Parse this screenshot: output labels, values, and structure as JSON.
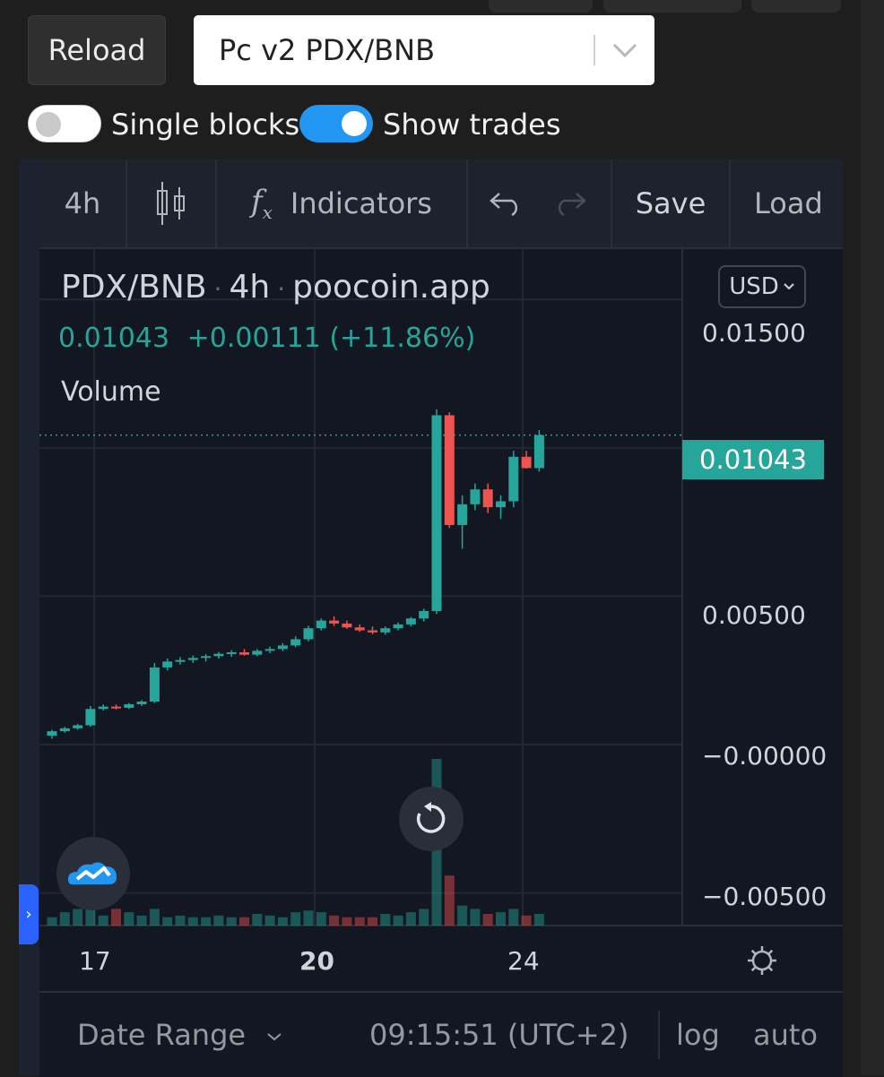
{
  "top_controls": {
    "reload_label": "Reload",
    "pair_value": "Pc v2 PDX/BNB"
  },
  "toggles": {
    "single_blocks": {
      "label": "Single blocks",
      "on": false
    },
    "show_trades": {
      "label": "Show trades",
      "on": true
    }
  },
  "toolbar": {
    "interval": "4h",
    "indicators_label": "Indicators",
    "save_label": "Save",
    "load_label": "Load"
  },
  "legend": {
    "symbol": "PDX/BNB",
    "interval": "4h",
    "source": "poocoin.app",
    "dot": "·",
    "last_price": "0.01043",
    "change": "+0.00111 (+11.86%)",
    "volume_label": "Volume"
  },
  "currency_button": "USD",
  "price_tag": "0.01043",
  "bottom_bar": {
    "date_range_label": "Date Range",
    "time": "09:15:51 (UTC+2)",
    "log_label": "log",
    "auto_label": "auto"
  },
  "colors": {
    "up": "#26a69a",
    "down": "#ef5350",
    "background": "#131722",
    "accent": "#2196f3"
  },
  "chart_data": {
    "type": "candlestick",
    "yaxis_ticks": [
      "0.01500",
      "0.00500",
      "−0.00000",
      "−0.00500"
    ],
    "xaxis_ticks": [
      "17",
      "20",
      "24"
    ],
    "xaxis_bold_tick": "20",
    "ylim": [
      -0.0061,
      0.0167
    ],
    "last_price": 0.01043,
    "grid": true,
    "candles": [
      {
        "o": 0.0003,
        "h": 0.0005,
        "l": 0.0002,
        "c": 0.00045
      },
      {
        "o": 0.00045,
        "h": 0.0006,
        "l": 0.0004,
        "c": 0.00055
      },
      {
        "o": 0.00055,
        "h": 0.0007,
        "l": 0.0005,
        "c": 0.00065
      },
      {
        "o": 0.00065,
        "h": 0.0013,
        "l": 0.0006,
        "c": 0.0012
      },
      {
        "o": 0.0012,
        "h": 0.00135,
        "l": 0.00115,
        "c": 0.00128
      },
      {
        "o": 0.00128,
        "h": 0.00135,
        "l": 0.00118,
        "c": 0.00124
      },
      {
        "o": 0.00124,
        "h": 0.0014,
        "l": 0.0012,
        "c": 0.00136
      },
      {
        "o": 0.00136,
        "h": 0.0015,
        "l": 0.0013,
        "c": 0.00145
      },
      {
        "o": 0.00145,
        "h": 0.00275,
        "l": 0.0014,
        "c": 0.0026
      },
      {
        "o": 0.0026,
        "h": 0.0029,
        "l": 0.0025,
        "c": 0.0028
      },
      {
        "o": 0.0028,
        "h": 0.00295,
        "l": 0.0027,
        "c": 0.00285
      },
      {
        "o": 0.00285,
        "h": 0.003,
        "l": 0.00275,
        "c": 0.00292
      },
      {
        "o": 0.00292,
        "h": 0.00305,
        "l": 0.0028,
        "c": 0.00298
      },
      {
        "o": 0.00298,
        "h": 0.00312,
        "l": 0.0029,
        "c": 0.00306
      },
      {
        "o": 0.00306,
        "h": 0.00318,
        "l": 0.00296,
        "c": 0.00311
      },
      {
        "o": 0.00311,
        "h": 0.00322,
        "l": 0.003,
        "c": 0.00303
      },
      {
        "o": 0.00303,
        "h": 0.00322,
        "l": 0.00298,
        "c": 0.00316
      },
      {
        "o": 0.00316,
        "h": 0.0033,
        "l": 0.00308,
        "c": 0.00322
      },
      {
        "o": 0.00322,
        "h": 0.00342,
        "l": 0.00315,
        "c": 0.00334
      },
      {
        "o": 0.00334,
        "h": 0.00365,
        "l": 0.00328,
        "c": 0.00355
      },
      {
        "o": 0.00355,
        "h": 0.004,
        "l": 0.00348,
        "c": 0.00392
      },
      {
        "o": 0.00392,
        "h": 0.00425,
        "l": 0.00385,
        "c": 0.00418
      },
      {
        "o": 0.00418,
        "h": 0.00432,
        "l": 0.004,
        "c": 0.00408
      },
      {
        "o": 0.00408,
        "h": 0.00418,
        "l": 0.0039,
        "c": 0.00395
      },
      {
        "o": 0.00395,
        "h": 0.00405,
        "l": 0.0038,
        "c": 0.00385
      },
      {
        "o": 0.00385,
        "h": 0.00398,
        "l": 0.00372,
        "c": 0.00378
      },
      {
        "o": 0.00378,
        "h": 0.00398,
        "l": 0.0037,
        "c": 0.00392
      },
      {
        "o": 0.00392,
        "h": 0.00412,
        "l": 0.00385,
        "c": 0.00405
      },
      {
        "o": 0.00405,
        "h": 0.0043,
        "l": 0.00398,
        "c": 0.00425
      },
      {
        "o": 0.00425,
        "h": 0.00458,
        "l": 0.00415,
        "c": 0.0045
      },
      {
        "o": 0.0045,
        "h": 0.0113,
        "l": 0.0044,
        "c": 0.0111
      },
      {
        "o": 0.0111,
        "h": 0.0112,
        "l": 0.0073,
        "c": 0.0074
      },
      {
        "o": 0.0074,
        "h": 0.0084,
        "l": 0.0066,
        "c": 0.0081
      },
      {
        "o": 0.0081,
        "h": 0.0088,
        "l": 0.0079,
        "c": 0.0086
      },
      {
        "o": 0.0086,
        "h": 0.0088,
        "l": 0.0078,
        "c": 0.008
      },
      {
        "o": 0.008,
        "h": 0.0084,
        "l": 0.0076,
        "c": 0.0082
      },
      {
        "o": 0.0082,
        "h": 0.0099,
        "l": 0.008,
        "c": 0.0097
      },
      {
        "o": 0.0097,
        "h": 0.0099,
        "l": 0.0093,
        "c": 0.00932
      },
      {
        "o": 0.00932,
        "h": 0.0106,
        "l": 0.0092,
        "c": 0.01043
      }
    ],
    "volume_fraction": [
      0.05,
      0.08,
      0.1,
      0.1,
      0.06,
      0.1,
      0.08,
      0.06,
      0.1,
      0.05,
      0.06,
      0.05,
      0.05,
      0.06,
      0.05,
      0.05,
      0.07,
      0.06,
      0.05,
      0.08,
      0.09,
      0.08,
      0.06,
      0.05,
      0.05,
      0.05,
      0.07,
      0.06,
      0.08,
      0.1,
      1.0,
      0.3,
      0.12,
      0.1,
      0.07,
      0.08,
      0.1,
      0.06,
      0.07
    ]
  }
}
